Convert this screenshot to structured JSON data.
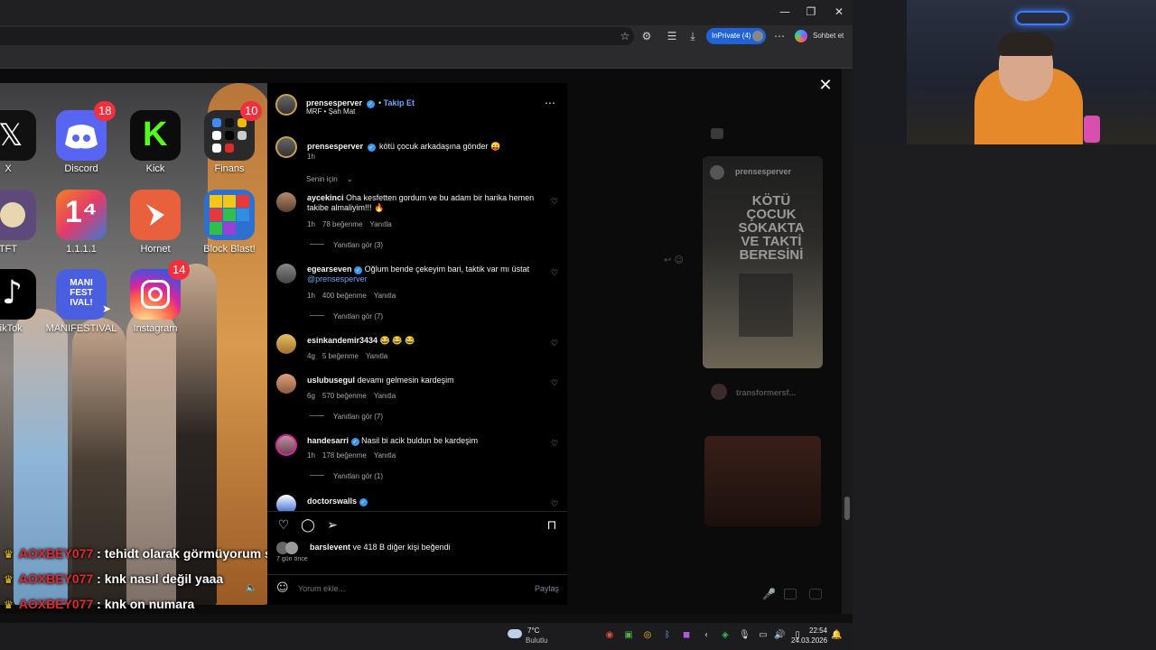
{
  "browser": {
    "window_controls": {
      "minimize": "—",
      "maximize": "❐",
      "close": "✕"
    },
    "inprivate_label": "InPrivate (4)",
    "copilot_label": "Sohbet et",
    "toolbar_icons": [
      "star-icon",
      "extensions-icon",
      "favorites-icon",
      "download-icon",
      "more-icon"
    ]
  },
  "phone": {
    "apps": [
      {
        "label": "X",
        "badge": "",
        "color": "#111111"
      },
      {
        "label": "Discord",
        "badge": "18",
        "color": "#5865f2"
      },
      {
        "label": "Kick",
        "badge": "",
        "color": "#0c0c0c"
      },
      {
        "label": "Finans",
        "badge": "10",
        "color": "#2a2a2a"
      },
      {
        "label": "TFT",
        "badge": "",
        "color": "#5d4a7a"
      },
      {
        "label": "1.1.1.1",
        "badge": "",
        "color": "#f38020"
      },
      {
        "label": "Hornet",
        "badge": "",
        "color": "#e8603c"
      },
      {
        "label": "Block Blast!",
        "badge": "",
        "color": "#2f6fd0"
      },
      {
        "label": "TikTok",
        "badge": "",
        "color": "#000000"
      },
      {
        "label": "MANIFESTIVAL",
        "badge": "",
        "color": "#4a5fe0"
      },
      {
        "label": "Instagram",
        "badge": "14",
        "color": "#d6249f"
      }
    ],
    "app_1111_glyph": "1⁴",
    "manifestival_glyph": "MANI FEST IVAL!"
  },
  "chat": [
    {
      "user": "AOXBEY077",
      "message": ": tehidt olarak görmüyorum senis"
    },
    {
      "user": "AOXBEY077",
      "message": ": knk nasıl değil yaaa"
    },
    {
      "user": "AOXBEY077",
      "message": ": knk on numara"
    }
  ],
  "post": {
    "author": "prensesperver",
    "follow": "Takip Et",
    "subtitle": "MRF • Şah Mat",
    "caption": "kötü çocuk arkadaşına gönder",
    "caption_time": "1h",
    "sort_label": "Senin için",
    "comments": [
      {
        "user": "aycekinci",
        "verified": false,
        "text": "Oha kesfetten gordum ve bu adam bir harika hemen takibe almaliyim!!! 🔥",
        "time": "1h",
        "likes": "78 beğenme",
        "reply": "Yanıtla",
        "more_replies": "Yanıtları gör (3)"
      },
      {
        "user": "egearseven",
        "verified": true,
        "text": "Oğlum bende çekeyim bari, taktik var mı üstat",
        "mention": "@prensesperver",
        "time": "1h",
        "likes": "400 beğenme",
        "reply": "Yanıtla",
        "more_replies": "Yanıtları gör (7)"
      },
      {
        "user": "esinkandemir3434",
        "verified": false,
        "text": "😂 😂 😂",
        "time": "4g",
        "likes": "5 beğenme",
        "reply": "Yanıtla",
        "more_replies": ""
      },
      {
        "user": "uslubusegul",
        "verified": false,
        "text": "devamı gelmesin kardeşim",
        "time": "6g",
        "likes": "570 beğenme",
        "reply": "Yanıtla",
        "more_replies": "Yanıtları gör (7)"
      },
      {
        "user": "handesarri",
        "verified": true,
        "text": "Nasil bi acik buldun be kardeşim",
        "time": "1h",
        "likes": "178 beğenme",
        "reply": "Yanıtla",
        "more_replies": "Yanıtları gör (1)"
      },
      {
        "user": "doctorswalls",
        "verified": true,
        "text": "",
        "time": "",
        "likes": "",
        "reply": "",
        "more_replies": ""
      }
    ],
    "likes_summary_user": "barslevent",
    "likes_summary_rest": " ve 418 B diğer kişi beğendi",
    "posted_ago": "7 gün önce",
    "comment_placeholder": "Yorum ekle...",
    "share_label": "Paylaş"
  },
  "sidebar": {
    "card1_user": "prensesperver",
    "card1_title": "KÖTÜ ÇOCUK SOKAKTA VE TAKTİ BERESİNİ",
    "card2_user": "transformersf..."
  },
  "taskbar": {
    "weather_temp": "7°C",
    "weather_desc": "Bulutlu",
    "time": "22:54",
    "date": "24.03.2026"
  }
}
